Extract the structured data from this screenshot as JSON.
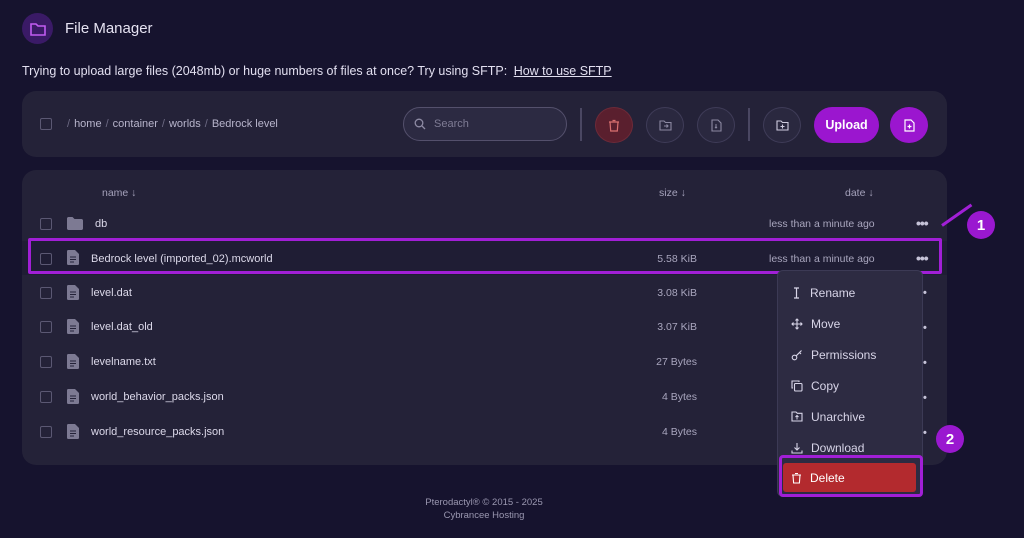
{
  "header": {
    "title": "File Manager"
  },
  "notice": {
    "text": "Trying to upload large files (2048mb) or huge numbers of files at once? Try using SFTP:",
    "link": "How to use SFTP"
  },
  "breadcrumb": {
    "sep": "/",
    "parts": [
      "home",
      "container",
      "worlds",
      "Bedrock level"
    ]
  },
  "search": {
    "placeholder": "Search"
  },
  "toolbar": {
    "upload_label": "Upload"
  },
  "columns": {
    "name": "name ↓",
    "size": "size ↓",
    "date": "date ↓"
  },
  "files": [
    {
      "type": "folder",
      "name": "db",
      "size": "",
      "date": "less than a minute ago"
    },
    {
      "type": "file",
      "name": "Bedrock level (imported_02).mcworld",
      "size": "5.58 KiB",
      "date": "less than a minute ago"
    },
    {
      "type": "file",
      "name": "level.dat",
      "size": "3.08 KiB",
      "date": ""
    },
    {
      "type": "file",
      "name": "level.dat_old",
      "size": "3.07 KiB",
      "date": ""
    },
    {
      "type": "file",
      "name": "levelname.txt",
      "size": "27 Bytes",
      "date": ""
    },
    {
      "type": "file",
      "name": "world_behavior_packs.json",
      "size": "4 Bytes",
      "date": ""
    },
    {
      "type": "file",
      "name": "world_resource_packs.json",
      "size": "4 Bytes",
      "date": ""
    }
  ],
  "row_menu_glyph": "•••",
  "context_menu": {
    "items": [
      {
        "label": "Rename",
        "icon": "cursor-icon"
      },
      {
        "label": "Move",
        "icon": "move-icon"
      },
      {
        "label": "Permissions",
        "icon": "key-icon"
      },
      {
        "label": "Copy",
        "icon": "copy-icon"
      },
      {
        "label": "Unarchive",
        "icon": "unarchive-icon"
      },
      {
        "label": "Download",
        "icon": "download-icon"
      },
      {
        "label": "Delete",
        "icon": "trash-icon"
      }
    ]
  },
  "callouts": [
    "1",
    "2"
  ],
  "footer": {
    "line1": "Pterodactyl® © 2015 - 2025",
    "line2": "Cybrancee Hosting"
  },
  "colors": {
    "accent": "#9b16cf",
    "danger": "#b32a2e",
    "background": "#16132e",
    "panel": "#242238"
  }
}
